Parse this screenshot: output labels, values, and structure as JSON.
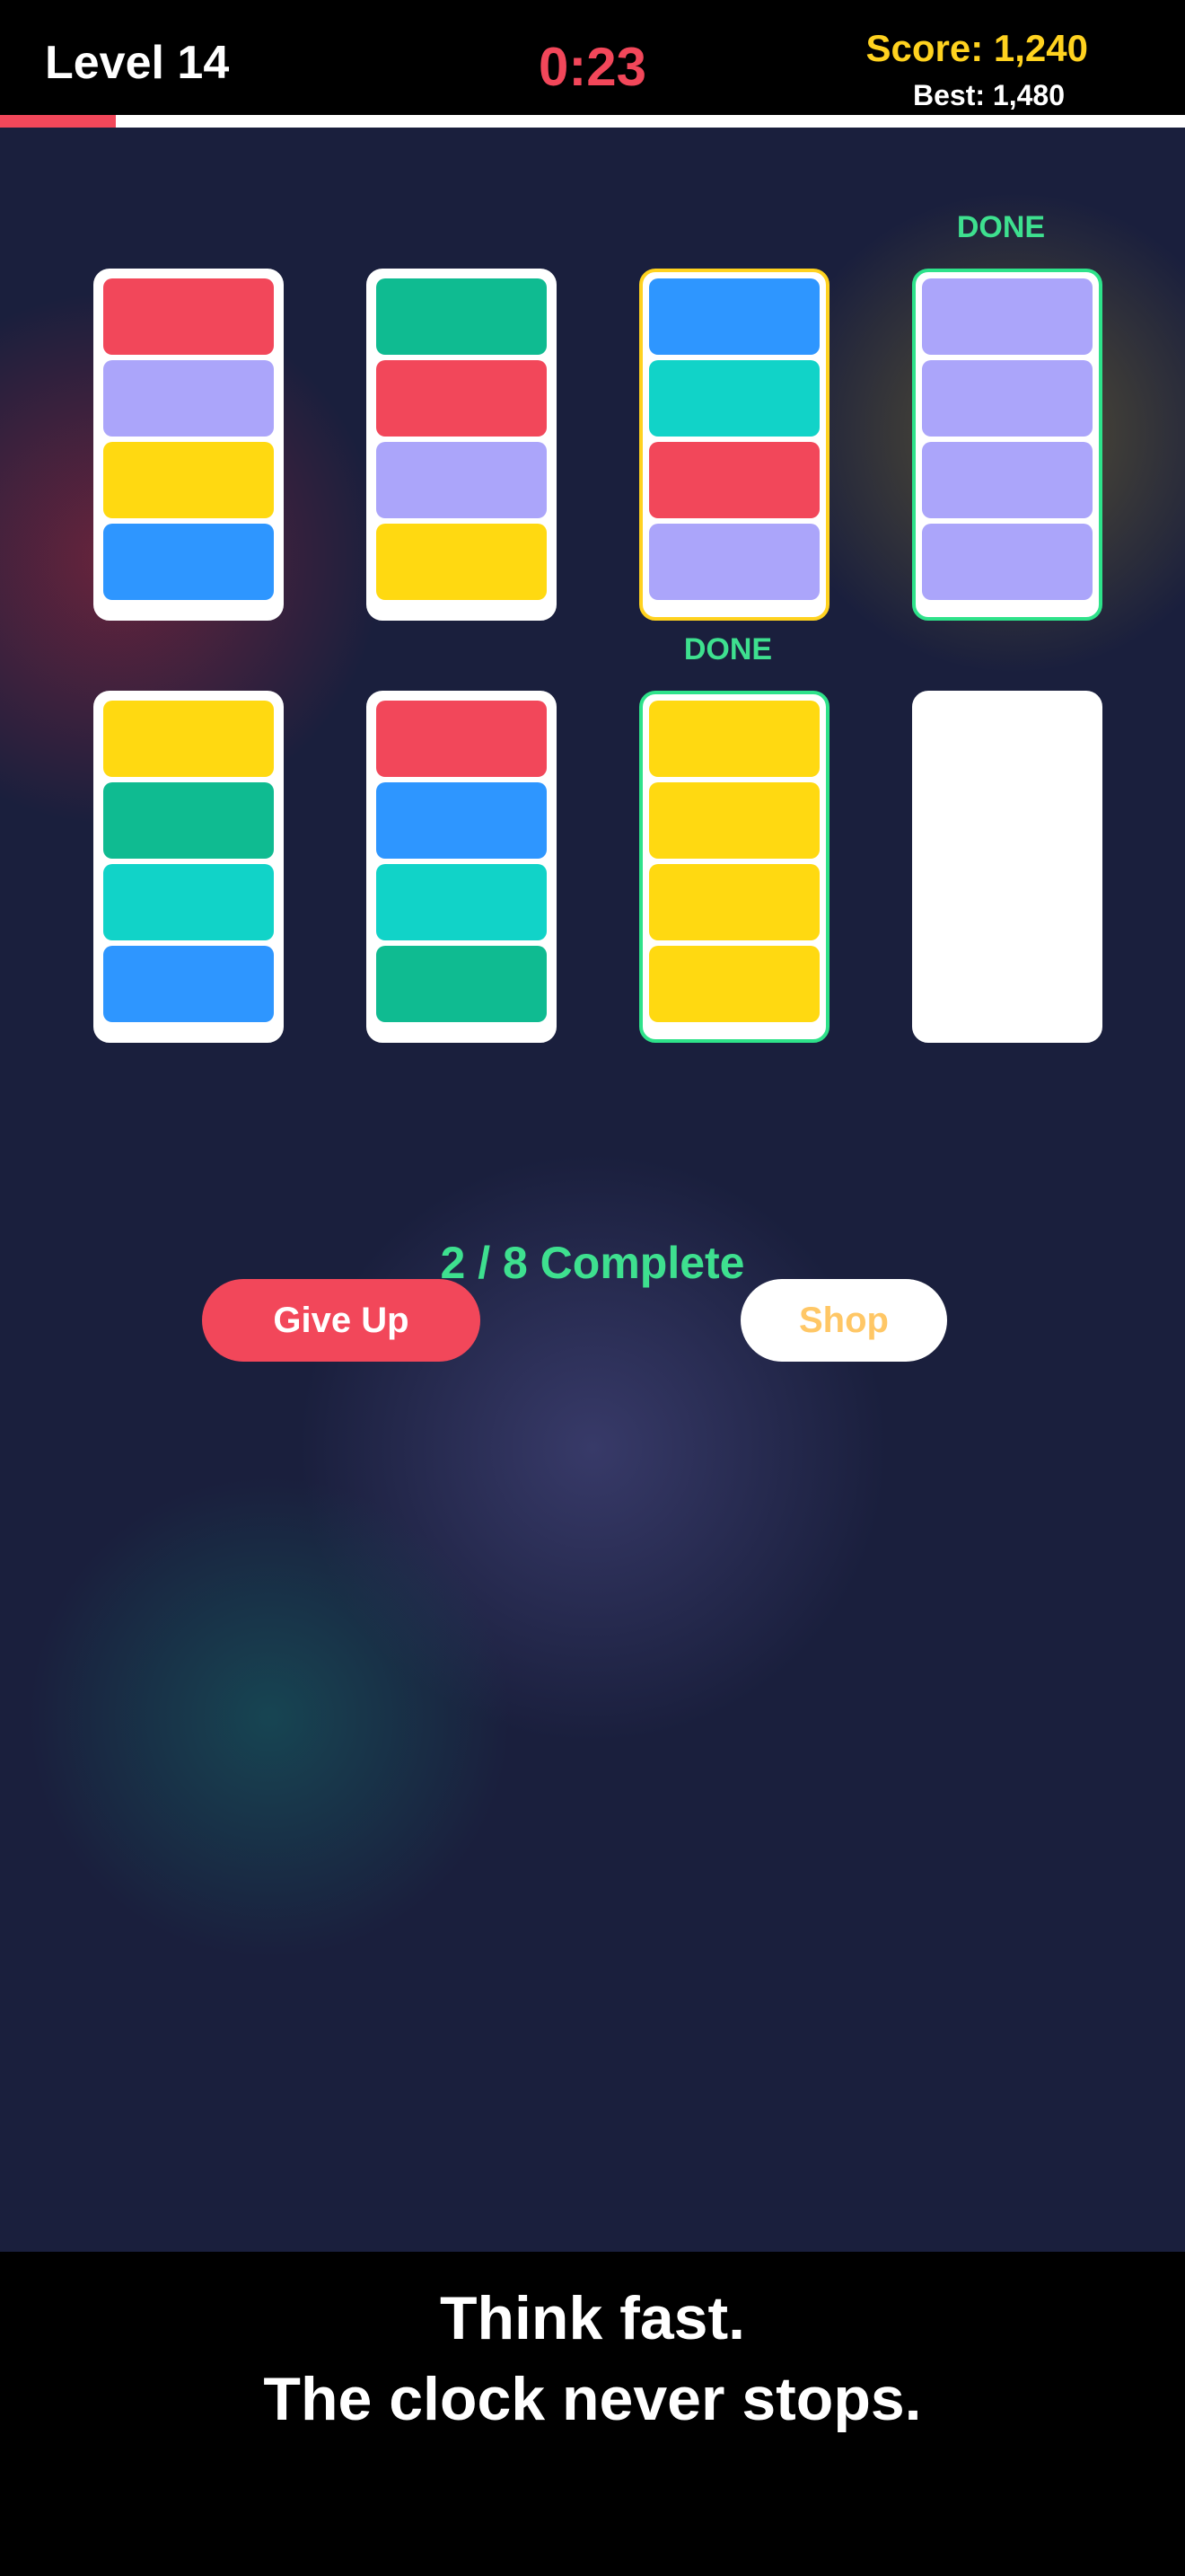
{
  "header": {
    "level": "Level 14",
    "timer": "0:23",
    "score": "Score: 1,240",
    "best": "Best: 1,480",
    "time_remaining_fraction": 0.098
  },
  "colors": {
    "red": "#f2475a",
    "purple": "#aba5fa",
    "yellow": "#ffd911",
    "blue": "#2e96ff",
    "green": "#0fbb91",
    "teal": "#11d3c8",
    "done_accent": "#3ee08f",
    "selected_accent": "#ffd21f"
  },
  "tubes": [
    {
      "segments": [
        "red",
        "purple",
        "yellow",
        "blue"
      ],
      "state": "normal"
    },
    {
      "segments": [
        "green",
        "red",
        "purple",
        "yellow"
      ],
      "state": "normal"
    },
    {
      "segments": [
        "blue",
        "teal",
        "red",
        "purple"
      ],
      "state": "selected"
    },
    {
      "segments": [
        "purple",
        "purple",
        "purple",
        "purple"
      ],
      "state": "done",
      "label": "DONE"
    },
    {
      "segments": [
        "yellow",
        "green",
        "teal",
        "blue"
      ],
      "state": "normal"
    },
    {
      "segments": [
        "red",
        "blue",
        "teal",
        "green"
      ],
      "state": "normal"
    },
    {
      "segments": [
        "yellow",
        "yellow",
        "yellow",
        "yellow"
      ],
      "state": "done",
      "label": "DONE"
    },
    {
      "segments": [],
      "state": "empty"
    }
  ],
  "progress": "2 / 8 Complete",
  "buttons": {
    "give_up": "Give Up",
    "shop": "Shop"
  },
  "tagline": {
    "line1": "Think fast.",
    "line2": "The clock never stops."
  }
}
